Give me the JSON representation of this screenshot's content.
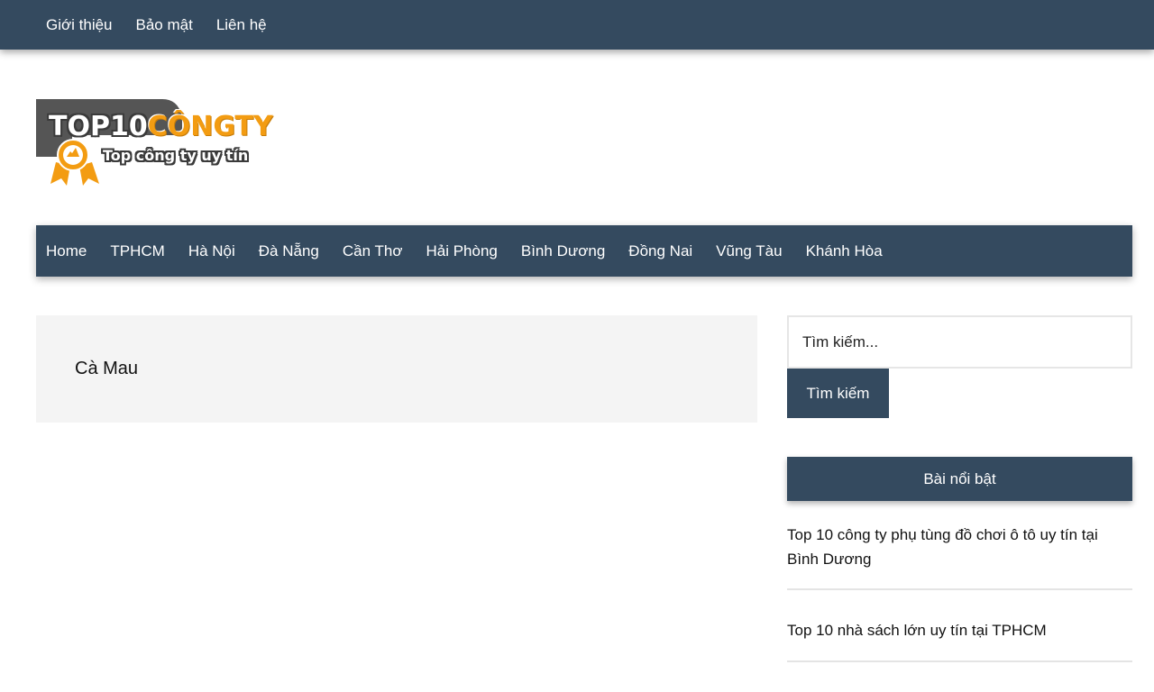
{
  "topbar": {
    "links": [
      "Giới thiệu",
      "Bảo mật",
      "Liên hệ"
    ]
  },
  "logo": {
    "main_white": "TOP10",
    "main_orange": "CÔNGTY",
    "tagline": "Top công ty uy tín"
  },
  "mainnav": {
    "items": [
      "Home",
      "TPHCM",
      "Hà Nội",
      "Đà Nẵng",
      "Cần Thơ",
      "Hải Phòng",
      "Bình Dương",
      "Đồng Nai",
      "Vũng Tàu",
      "Khánh Hòa"
    ]
  },
  "content": {
    "title": "Cà Mau"
  },
  "sidebar": {
    "search": {
      "placeholder": "Tìm kiếm...",
      "button_label": "Tìm kiếm"
    },
    "featured": {
      "title": "Bài nổi bật",
      "posts": [
        "Top 10 công ty phụ tùng đồ chơi ô tô uy tín tại Bình Dương",
        "Top 10 nhà sách lớn uy tín tại TPHCM"
      ]
    }
  },
  "colors": {
    "nav_bg": "#344a5f",
    "logo_orange": "#f39c12",
    "content_bg": "#f4f4f4"
  }
}
